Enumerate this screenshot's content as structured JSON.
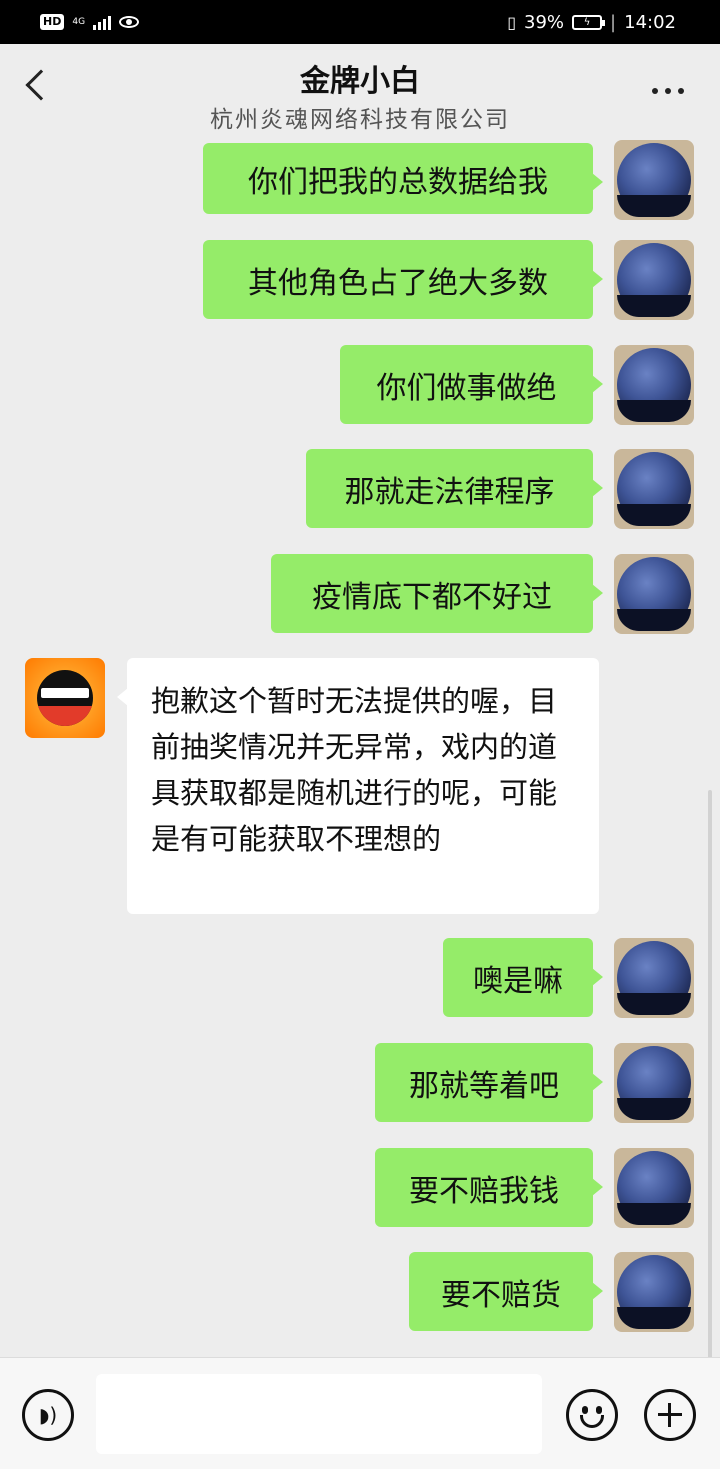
{
  "status_bar": {
    "hd": "HD",
    "network": "4G",
    "battery": "39%",
    "time": "14:02"
  },
  "header": {
    "title": "金牌小白",
    "subtitle": "杭州炎魂网络科技有限公司"
  },
  "messages": [
    {
      "from": "me",
      "text": "你们把我的总数据给我"
    },
    {
      "from": "me",
      "text": "其他角色占了绝大多数"
    },
    {
      "from": "me",
      "text": "你们做事做绝"
    },
    {
      "from": "me",
      "text": "那就走法律程序"
    },
    {
      "from": "me",
      "text": "疫情底下都不好过"
    },
    {
      "from": "other",
      "text": "抱歉这个暂时无法提供的喔，目前抽奖情况并无异常，戏内的道具获取都是随机进行的呢，可能是有可能获取不理想的"
    },
    {
      "from": "me",
      "text": "噢是嘛"
    },
    {
      "from": "me",
      "text": "那就等着吧"
    },
    {
      "from": "me",
      "text": "要不赔我钱"
    },
    {
      "from": "me",
      "text": "要不赔货"
    }
  ],
  "input": {
    "value": "",
    "voice_icon": "voice-icon",
    "emoji_icon": "emoji-icon",
    "plus_icon": "plus-icon"
  },
  "colors": {
    "my_bubble": "#95ec69",
    "other_bubble": "#ffffff",
    "background": "#ededed"
  }
}
